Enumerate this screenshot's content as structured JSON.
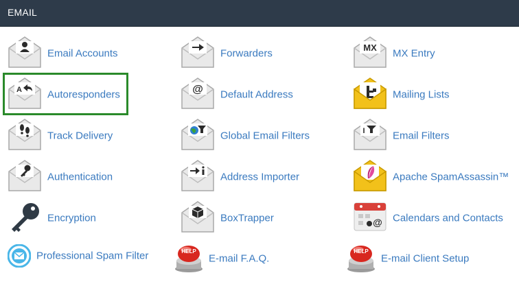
{
  "header": {
    "title": "EMAIL"
  },
  "colors": {
    "header_bg": "#2e3b4a",
    "link": "#3a7abf",
    "highlight": "#2a8a2a"
  },
  "items": [
    {
      "label": "Email Accounts",
      "icon": "person-envelope-icon"
    },
    {
      "label": "Forwarders",
      "icon": "arrow-envelope-icon"
    },
    {
      "label": "MX Entry",
      "icon": "mx-envelope-icon"
    },
    {
      "label": "Autoresponders",
      "icon": "reply-envelope-icon"
    },
    {
      "label": "Default Address",
      "icon": "at-envelope-icon"
    },
    {
      "label": "Mailing Lists",
      "icon": "mailing-list-envelope-icon"
    },
    {
      "label": "Track Delivery",
      "icon": "footprints-envelope-icon"
    },
    {
      "label": "Global Email Filters",
      "icon": "globe-filter-envelope-icon"
    },
    {
      "label": "Email Filters",
      "icon": "filter-envelope-icon"
    },
    {
      "label": "Authentication",
      "icon": "key-envelope-icon"
    },
    {
      "label": "Address Importer",
      "icon": "import-envelope-icon"
    },
    {
      "label": "Apache SpamAssassin™",
      "icon": "feather-envelope-icon"
    },
    {
      "label": "Encryption",
      "icon": "key-icon"
    },
    {
      "label": "BoxTrapper",
      "icon": "box-envelope-icon"
    },
    {
      "label": "Calendars and Contacts",
      "icon": "calendar-icon"
    },
    {
      "label": "Professional Spam Filter",
      "icon": "spam-filter-icon"
    },
    {
      "label": "E-mail F.A.Q.",
      "icon": "help-button-icon"
    },
    {
      "label": "E-mail Client Setup",
      "icon": "help-button-icon"
    }
  ]
}
